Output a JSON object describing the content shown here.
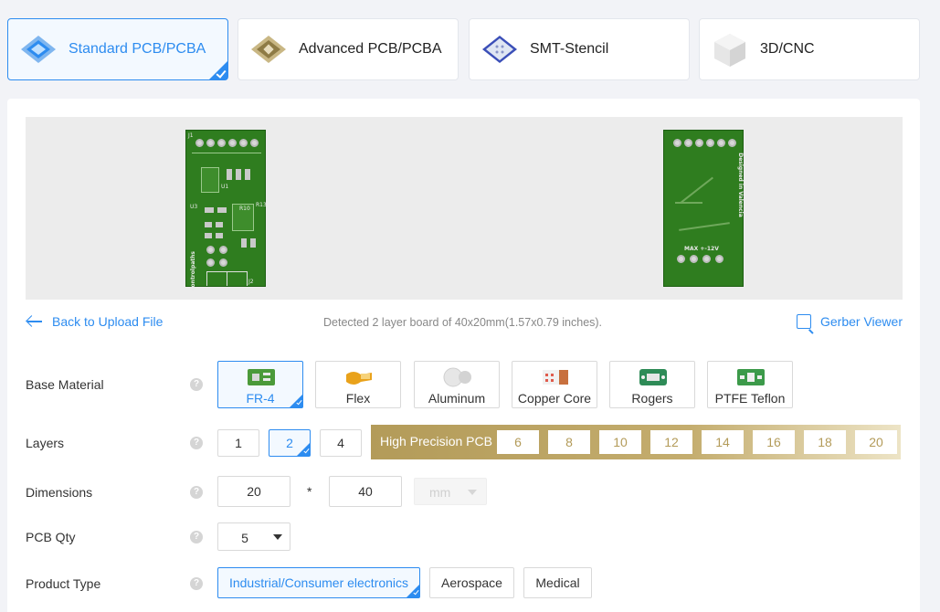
{
  "tabs": [
    {
      "label": "Standard PCB/PCBA",
      "icon": "standard-pcb-icon",
      "active": true
    },
    {
      "label": "Advanced PCB/PCBA",
      "icon": "advanced-pcb-icon",
      "active": false
    },
    {
      "label": "SMT-Stencil",
      "icon": "smt-stencil-icon",
      "active": false
    },
    {
      "label": "3D/CNC",
      "icon": "3d-cnc-icon",
      "active": false
    }
  ],
  "preview": {
    "top_silk": [
      "J1",
      "U1",
      "U3",
      "R10",
      "R13",
      "controlpaths",
      "J2"
    ],
    "bottom_silk": [
      "Designed in Valencia",
      "MAX +-12V"
    ]
  },
  "actions": {
    "back_label": "Back to Upload File",
    "detected_text": "Detected 2 layer board of 40x20mm(1.57x0.79 inches).",
    "gerber_label": "Gerber Viewer"
  },
  "base_material": {
    "label": "Base Material",
    "options": [
      "FR-4",
      "Flex",
      "Aluminum",
      "Copper Core",
      "Rogers",
      "PTFE Teflon"
    ],
    "selected": "FR-4"
  },
  "layers": {
    "label": "Layers",
    "options": [
      "1",
      "2",
      "4"
    ],
    "selected": "2",
    "high_precision_label": "High Precision PCB",
    "high_precision_options": [
      "6",
      "8",
      "10",
      "12",
      "14",
      "16",
      "18",
      "20"
    ]
  },
  "dimensions": {
    "label": "Dimensions",
    "width": "20",
    "separator": "*",
    "height": "40",
    "unit": "mm"
  },
  "pcb_qty": {
    "label": "PCB Qty",
    "value": "5"
  },
  "product_type": {
    "label": "Product Type",
    "options": [
      "Industrial/Consumer electronics",
      "Aerospace",
      "Medical"
    ],
    "selected": "Industrial/Consumer electronics"
  },
  "help_glyph": "?",
  "colors": {
    "accent": "#2d8cf0",
    "gold": "#b39b59",
    "pcb_green": "#2f7d1f"
  }
}
